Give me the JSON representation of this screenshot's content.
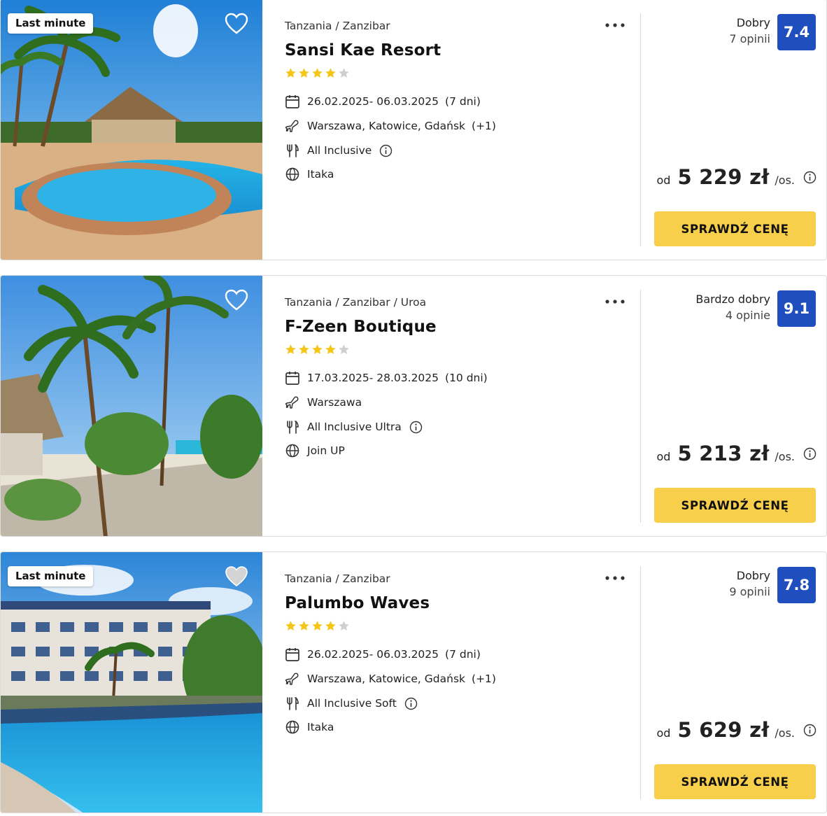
{
  "offers": [
    {
      "badge": "Last minute",
      "favorite": "outline",
      "location": "Tanzania / Zanzibar",
      "name": "Sansi Kae Resort",
      "stars": 4,
      "dates": "26.02.2025- 06.03.2025",
      "duration": "(7 dni)",
      "departures": "Warszawa, Katowice, Gdańsk",
      "departures_extra": "(+1)",
      "board": "All Inclusive",
      "operator": "Itaka",
      "rating_label": "Dobry",
      "reviews": "7 opinii",
      "score": "7.4",
      "price_prefix": "od",
      "price": "5 229 zł",
      "price_suffix": "/os.",
      "cta": "SPRAWDŹ CENĘ"
    },
    {
      "badge": "",
      "favorite": "outline",
      "location": "Tanzania / Zanzibar / Uroa",
      "name": "F-Zeen Boutique",
      "stars": 4,
      "dates": "17.03.2025- 28.03.2025",
      "duration": "(10 dni)",
      "departures": "Warszawa",
      "departures_extra": "",
      "board": "All Inclusive Ultra",
      "operator": "Join UP",
      "rating_label": "Bardzo dobry",
      "reviews": "4 opinie",
      "score": "9.1",
      "price_prefix": "od",
      "price": "5 213 zł",
      "price_suffix": "/os.",
      "cta": "SPRAWDŹ CENĘ"
    },
    {
      "badge": "Last minute",
      "favorite": "filled-gray",
      "location": "Tanzania / Zanzibar",
      "name": "Palumbo Waves",
      "stars": 4,
      "dates": "26.02.2025- 06.03.2025",
      "duration": "(7 dni)",
      "departures": "Warszawa, Katowice, Gdańsk",
      "departures_extra": "(+1)",
      "board": "All Inclusive Soft",
      "operator": "Itaka",
      "rating_label": "Dobry",
      "reviews": "9 opinii",
      "score": "7.8",
      "price_prefix": "od",
      "price": "5 629 zł",
      "price_suffix": "/os.",
      "cta": "SPRAWDŹ CENĘ"
    }
  ],
  "icons": {
    "calendar": "calendar-icon",
    "plane": "plane-icon",
    "board": "cutlery-icon",
    "operator": "globe-icon",
    "info": "info-icon",
    "more": "more-dots-icon",
    "favorite": "heart-icon",
    "star": "star-icon"
  },
  "colors": {
    "score_bg": "#1f4fbf",
    "cta_bg": "#f7cf4a",
    "star_on": "#f5c518",
    "star_off": "#cfcfcf"
  }
}
